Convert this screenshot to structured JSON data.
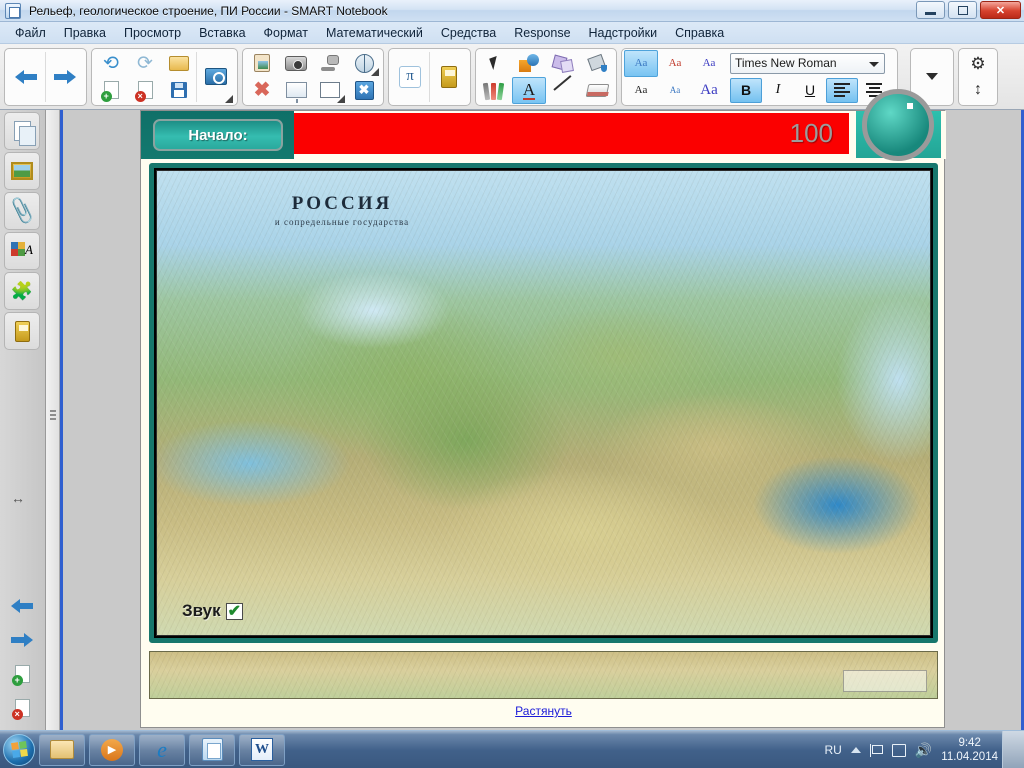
{
  "window": {
    "title": "Рельеф, геологическое строение, ПИ России - SMART Notebook",
    "app_icon": "notebook-icon",
    "controls": {
      "minimize": "minimize-icon",
      "restore": "restore-icon",
      "close": "✕"
    }
  },
  "menubar": {
    "items": [
      {
        "label": "Файл"
      },
      {
        "label": "Правка"
      },
      {
        "label": "Просмотр"
      },
      {
        "label": "Вставка"
      },
      {
        "label": "Формат"
      },
      {
        "label": "Математический"
      },
      {
        "label": "Средства"
      },
      {
        "label": "Response"
      },
      {
        "label": "Надстройки"
      },
      {
        "label": "Справка"
      }
    ]
  },
  "toolbar": {
    "nav": [
      {
        "icon": "arrow-left-icon"
      },
      {
        "icon": "arrow-right-icon"
      }
    ],
    "file_group_top": [
      {
        "icon": "undo-icon"
      },
      {
        "icon": "redo-icon"
      },
      {
        "icon": "open-folder-icon"
      }
    ],
    "file_group_bottom": [
      {
        "icon": "new-page-icon"
      },
      {
        "icon": "delete-page-icon"
      },
      {
        "icon": "save-icon"
      }
    ],
    "screen_group": [
      {
        "icon": "screen-shade-icon"
      }
    ],
    "insert_group_top": [
      {
        "icon": "paste-icon"
      },
      {
        "icon": "camera-icon"
      },
      {
        "icon": "document-camera-icon"
      },
      {
        "icon": "web-capture-icon"
      }
    ],
    "insert_group_bottom": [
      {
        "icon": "delete-icon"
      },
      {
        "icon": "screen-shade-panel-icon"
      },
      {
        "icon": "table-icon"
      },
      {
        "icon": "full-screen-icon"
      }
    ],
    "math_group": [
      {
        "icon": "math-pi-icon"
      },
      {
        "icon": "response-device-icon"
      }
    ],
    "tools_group_top": [
      {
        "icon": "select-pointer-icon"
      },
      {
        "icon": "shapes-icon"
      },
      {
        "icon": "regular-polygon-icon"
      },
      {
        "icon": "fill-bucket-icon"
      }
    ],
    "tools_group_bottom": [
      {
        "icon": "pens-icon"
      },
      {
        "icon": "text-tool-icon",
        "selected": true
      },
      {
        "icon": "line-icon"
      },
      {
        "icon": "eraser-icon"
      }
    ],
    "fontsize_group_top": [
      {
        "label": "Aa",
        "selected": true
      },
      {
        "label": "Aa"
      },
      {
        "label": "Aa"
      }
    ],
    "fontsize_group_bottom": [
      {
        "label": "Aa"
      },
      {
        "label": "Aa"
      },
      {
        "label": "Aa"
      }
    ],
    "font_select": {
      "value": "Times New Roman"
    },
    "format_buttons": [
      {
        "label": "B",
        "name": "bold-button",
        "active": true
      },
      {
        "label": "I",
        "name": "italic-button",
        "active": false
      },
      {
        "label": "U",
        "name": "underline-button",
        "active": false
      },
      {
        "label": "",
        "name": "align-left-button",
        "active": true
      },
      {
        "label": "",
        "name": "align-center-button",
        "active": false
      }
    ],
    "overflow": {
      "icon": "chevron-down-icon"
    },
    "settings": {
      "icon": "gear-icon"
    },
    "move_toolbar": {
      "icon": "move-vertical-icon"
    }
  },
  "sidebar": {
    "tabs": [
      {
        "icon": "page-sorter-icon",
        "name": "sidebar-item-page-sorter"
      },
      {
        "icon": "gallery-icon",
        "name": "sidebar-item-gallery"
      },
      {
        "icon": "attachments-icon",
        "name": "sidebar-item-attachments"
      },
      {
        "icon": "properties-icon",
        "name": "sidebar-item-properties"
      },
      {
        "icon": "add-ons-icon",
        "name": "sidebar-item-addons"
      },
      {
        "icon": "response-icon",
        "name": "sidebar-item-response"
      }
    ],
    "resize_handle": {
      "icon": "resize-horizontal-icon"
    },
    "bottom": [
      {
        "icon": "previous-page-icon",
        "name": "previous-page-button"
      },
      {
        "icon": "next-page-icon",
        "name": "next-page-button"
      },
      {
        "icon": "add-page-icon",
        "name": "add-page-button"
      },
      {
        "icon": "delete-page-icon",
        "name": "delete-page-button"
      }
    ]
  },
  "slide": {
    "start_button": "Начало:",
    "score": "100",
    "circle_button": {
      "icon": "round-teal-button"
    },
    "map": {
      "title": "РОССИЯ",
      "subtitle": "и сопредельные государства",
      "sound_label": "Звук",
      "sound_checked": true,
      "legend": "map-legend"
    },
    "stretch_link": "Растянуть"
  },
  "taskbar": {
    "start": {
      "icon": "windows-start-orb"
    },
    "apps": [
      {
        "icon": "file-explorer-icon",
        "name": "taskbar-file-explorer"
      },
      {
        "icon": "media-player-icon",
        "name": "taskbar-media-player"
      },
      {
        "icon": "internet-explorer-icon",
        "name": "taskbar-internet-explorer"
      },
      {
        "icon": "smart-notebook-icon",
        "name": "taskbar-smart-notebook"
      },
      {
        "icon": "word-icon",
        "name": "taskbar-word"
      }
    ],
    "tray": {
      "language": "RU",
      "hidden_icons": {
        "icon": "chevron-up-icon"
      },
      "action_center": {
        "icon": "flag-icon"
      },
      "network": {
        "icon": "network-icon"
      },
      "volume": {
        "icon": "volume-icon"
      },
      "time": "9:42",
      "date": "11.04.2014"
    },
    "show_desktop": {
      "name": "show-desktop-button"
    }
  },
  "colors": {
    "red_bar": "#fb0000",
    "teal": "#17776c",
    "link": "#1b1bd8",
    "accent_blue": "#2f5fd0"
  }
}
